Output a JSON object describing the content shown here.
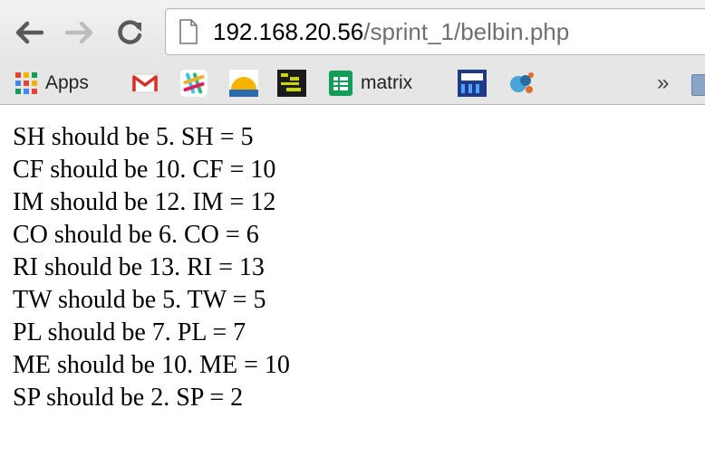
{
  "toolbar": {
    "url_host": "192.168.20.56",
    "url_path": "/sprint_1/belbin.php"
  },
  "bookmarks": {
    "items": [
      {
        "label": "Apps",
        "icon": "apps-grid-icon"
      },
      {
        "label": "",
        "icon": "gmail-icon"
      },
      {
        "label": "",
        "icon": "slack-icon"
      },
      {
        "label": "",
        "icon": "sunrise-icon"
      },
      {
        "label": "",
        "icon": "pixel-art-icon"
      },
      {
        "label": "matrix",
        "icon": "sheets-icon"
      },
      {
        "label": "",
        "icon": "htdp-icon"
      },
      {
        "label": "",
        "icon": "circles-icon"
      }
    ],
    "overflow_label": "»"
  },
  "content": {
    "lines": [
      "SH should be 5. SH = 5",
      "CF should be 10. CF = 10",
      "IM should be 12. IM = 12",
      "CO should be 6. CO = 6",
      "RI should be 13. RI = 13",
      "TW should be 5. TW = 5",
      "PL should be 7. PL = 7",
      "ME should be 10. ME = 10",
      "SP should be 2. SP = 2"
    ]
  },
  "colors": {
    "url_host": "#000000",
    "url_path": "#6f6f6f",
    "toolbar_bg": "#e6e6e6"
  }
}
